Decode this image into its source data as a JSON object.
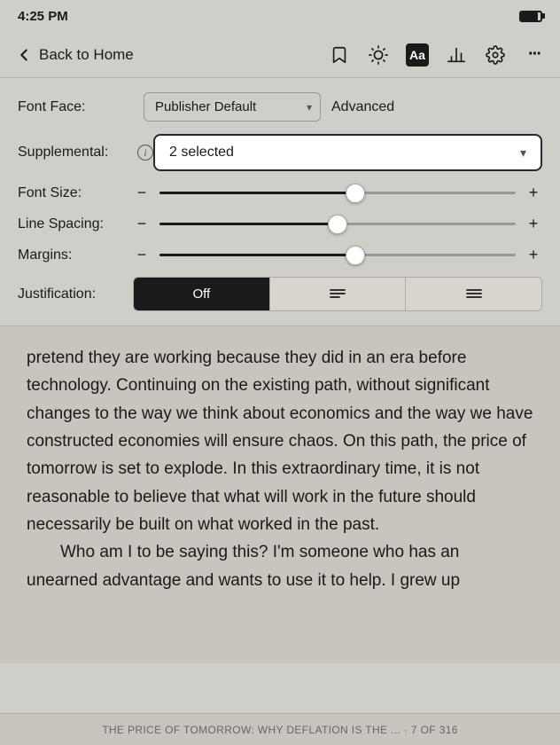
{
  "statusBar": {
    "time": "4:25 PM"
  },
  "navBar": {
    "backLabel": "Back to Home",
    "icons": {
      "bookmark": "🔖",
      "brightness": "☀",
      "font": "Aa",
      "chart": "📊",
      "settings": "⚙",
      "more": "···"
    }
  },
  "settings": {
    "fontFaceLabel": "Font Face:",
    "fontFaceValue": "Publisher Default",
    "advancedLabel": "Advanced",
    "supplementalLabel": "Supplemental:",
    "supplementalValue": "2 selected",
    "fontSizeLabel": "Font Size:",
    "lineSpacingLabel": "Line Spacing:",
    "marginsLabel": "Margins:",
    "justificationLabel": "Justification:",
    "justificationOptions": [
      "Off",
      "≡",
      "≡"
    ],
    "activeJustification": 0,
    "sliders": {
      "fontSize": 55,
      "lineSpacing": 50,
      "margins": 55
    }
  },
  "content": {
    "paragraph1": "pretend they are working because they did in an era before technology. Continuing on the existing path, without significant changes to the way we think about economics and the way we have constructed economies will ensure chaos. On this path, the price of tomorrow is set to explode. In this extraordinary time, it is not reasonable to believe that what will work in the future should necessarily be built on what worked in the past.",
    "paragraph2": "Who am I to be saying this? I'm someone who has an unearned advantage and wants to use it to help. I grew up"
  },
  "footer": {
    "text": "THE PRICE OF TOMORROW: WHY DEFLATION IS THE ... · 7 OF 316"
  }
}
